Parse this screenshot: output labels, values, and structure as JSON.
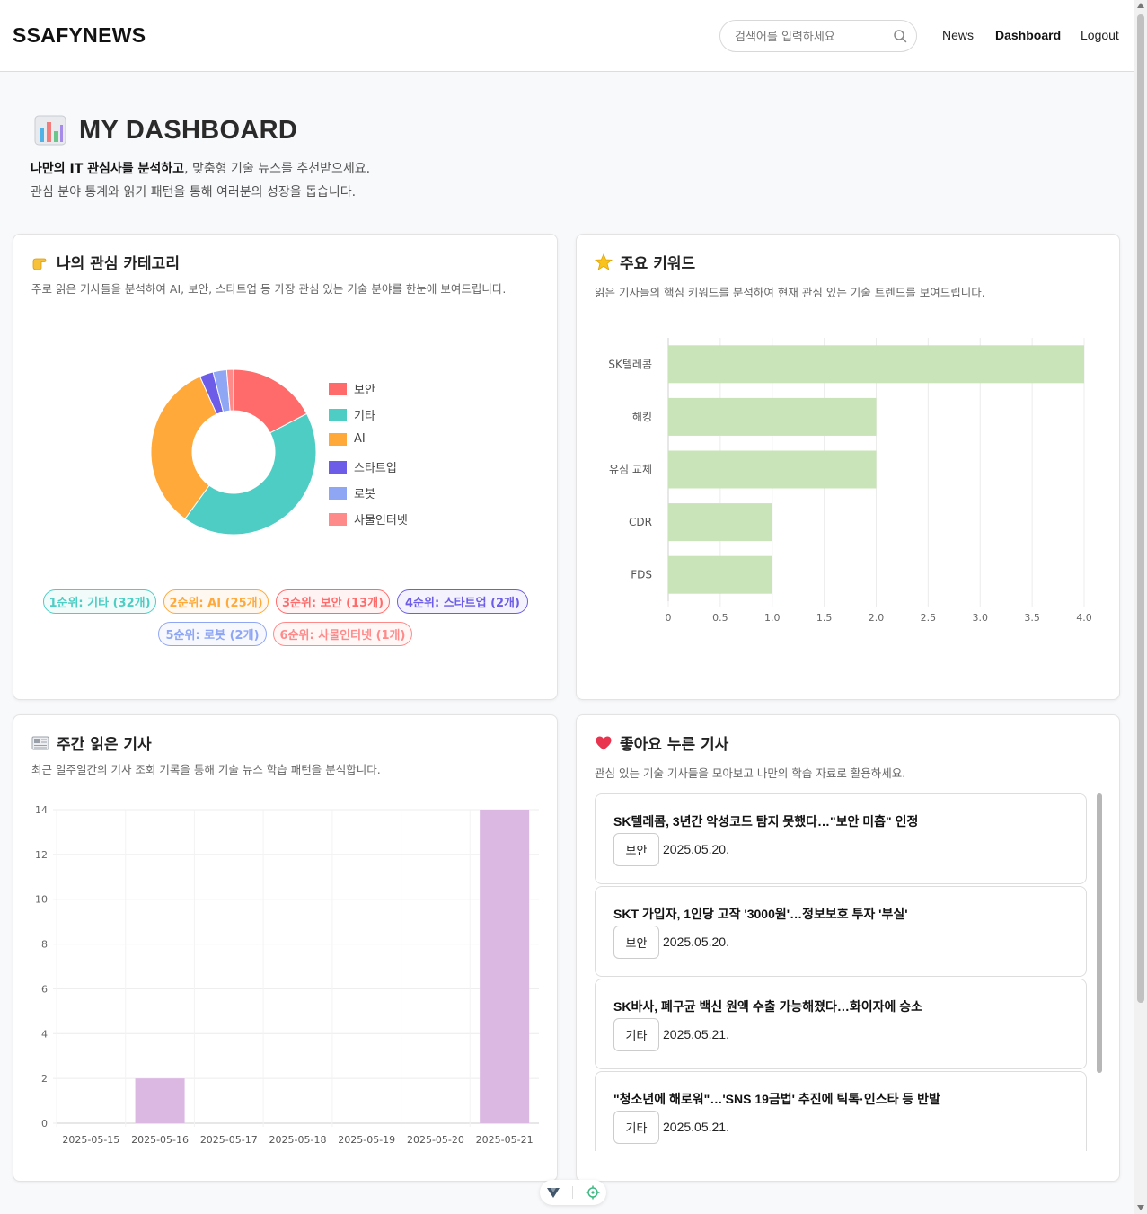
{
  "header": {
    "logo": "SSAFYNEWS",
    "search_placeholder": "검색어를 입력하세요",
    "nav": [
      {
        "label": "News"
      },
      {
        "label": "Dashboard"
      },
      {
        "label": "Logout"
      }
    ]
  },
  "hero": {
    "title": "MY DASHBOARD",
    "line1_bold": "나만의 IT 관심사를 분석하고",
    "line1_rest": ", 맞춤형 기술 뉴스를 추천받으세요.",
    "line2": "관심 분야 통계와 읽기 패턴을 통해 여러분의 성장을 돕습니다."
  },
  "category_card": {
    "title": "나의 관심 카테고리",
    "description": "주로 읽은 기사들을 분석하여 AI, 보안, 스타트업 등 가장 관심 있는 기술 분야를 한눈에 보여드립니다.",
    "ranks": [
      {
        "label": "1순위: 기타 (32개)",
        "color": "#4ecdc4"
      },
      {
        "label": "2순위: AI (25개)",
        "color": "#ffa93a"
      },
      {
        "label": "3순위: 보안 (13개)",
        "color": "#ff6b6b"
      },
      {
        "label": "4순위: 스타트업 (2개)",
        "color": "#6c5ce7"
      },
      {
        "label": "5순위: 로봇 (2개)",
        "color": "#8fa6f4"
      },
      {
        "label": "6순위: 사물인터넷 (1개)",
        "color": "#ff8a8a"
      }
    ]
  },
  "keyword_card": {
    "title": "주요 키워드",
    "description": "읽은 기사들의 핵심 키워드를 분석하여 현재 관심 있는 기술 트렌드를 보여드립니다."
  },
  "weekly_card": {
    "title": "주간 읽은 기사",
    "description": "최근 일주일간의 기사 조회 기록을 통해 기술 뉴스 학습 패턴을 분석합니다."
  },
  "liked_card": {
    "title": "좋아요 누른 기사",
    "description": "관심 있는 기술 기사들을 모아보고 나만의 학습 자료로 활용하세요.",
    "articles": [
      {
        "title": "SK텔레콤, 3년간 악성코드 탐지 못했다…\"보안 미흡\" 인정",
        "category": "보안",
        "date": "2025.05.20."
      },
      {
        "title": "SKT 가입자, 1인당 고작 '3000원'…정보보호 투자 '부실'",
        "category": "보안",
        "date": "2025.05.20."
      },
      {
        "title": "SK바사, 폐구균 백신 원액 수출 가능해졌다…화이자에 승소",
        "category": "기타",
        "date": "2025.05.21."
      },
      {
        "title": "\"청소년에 해로워\"…'SNS 19금법' 추진에 틱톡·인스타 등 반발",
        "category": "기타",
        "date": "2025.05.21."
      }
    ]
  },
  "chart_data": [
    {
      "type": "pie",
      "subtype": "doughnut",
      "categories": [
        "보안",
        "기타",
        "AI",
        "스타트업",
        "로봇",
        "사물인터넷"
      ],
      "values": [
        13,
        32,
        25,
        2,
        2,
        1
      ],
      "colors": [
        "#ff6b6b",
        "#4ecdc4",
        "#ffa93a",
        "#6c5ce7",
        "#8fa6f4",
        "#ff8a8a"
      ],
      "legend": "right"
    },
    {
      "type": "bar",
      "orientation": "horizontal",
      "categories": [
        "SK텔레콤",
        "해킹",
        "유심 교체",
        "CDR",
        "FDS"
      ],
      "values": [
        4,
        2,
        2,
        1,
        1
      ],
      "xlim": [
        0,
        4
      ],
      "xticks": [
        "0",
        "0.5",
        "1.0",
        "1.5",
        "2.0",
        "2.5",
        "3.0",
        "3.5",
        "4.0"
      ],
      "color": "#c8e4b8",
      "grid": true
    },
    {
      "type": "bar",
      "categories": [
        "2025-05-15",
        "2025-05-16",
        "2025-05-17",
        "2025-05-18",
        "2025-05-19",
        "2025-05-20",
        "2025-05-21"
      ],
      "values": [
        0,
        2,
        0,
        0,
        0,
        0,
        14
      ],
      "ylim": [
        0,
        14
      ],
      "yticks": [
        "0",
        "2",
        "4",
        "6",
        "8",
        "10",
        "12",
        "14"
      ],
      "color": "#dbb8e2",
      "grid": true
    }
  ]
}
